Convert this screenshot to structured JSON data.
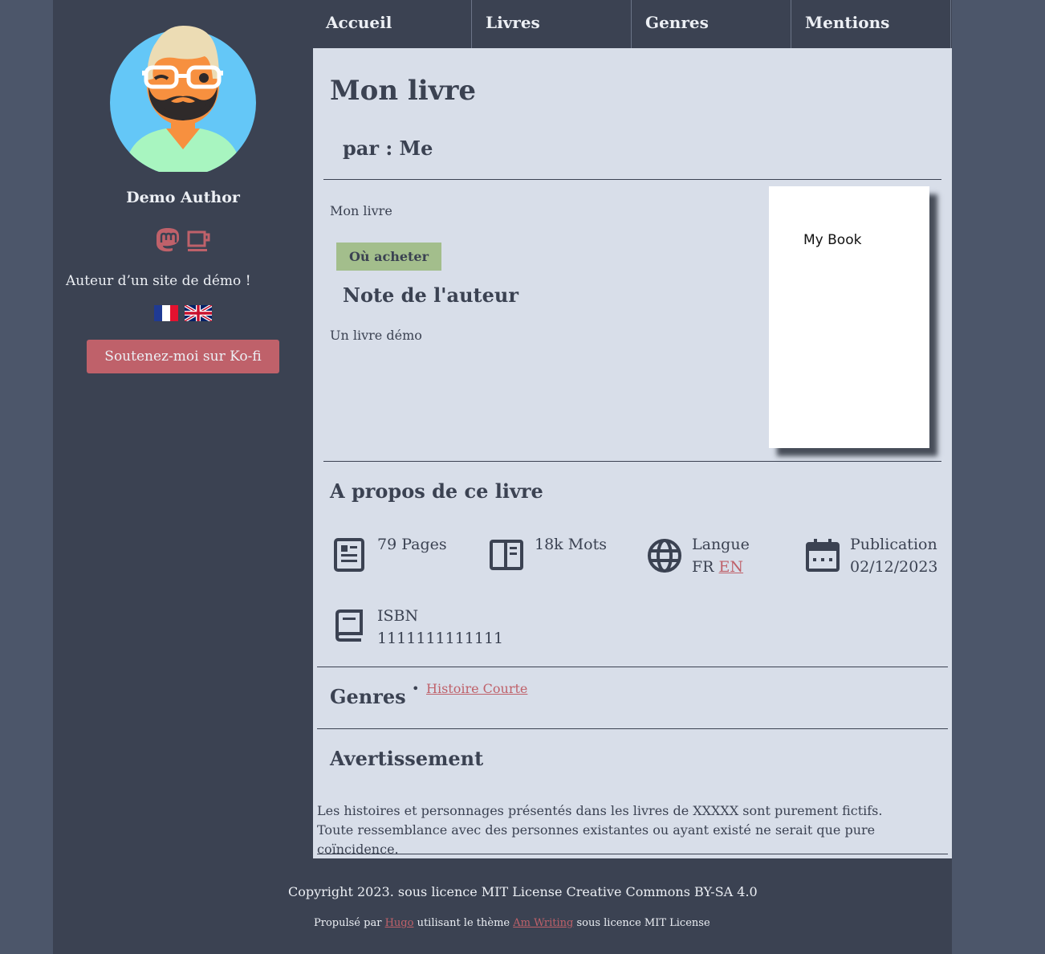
{
  "sidebar": {
    "author_name": "Demo Author",
    "tagline": "Auteur d’un site de démo !",
    "kofi_label": "Soutenez-moi sur Ko-fi",
    "icons": [
      "mastodon-icon",
      "kofi-cup-icon"
    ],
    "flags": [
      "fr-flag",
      "uk-flag"
    ]
  },
  "nav": {
    "items": [
      "Accueil",
      "Livres",
      "Genres",
      "Mentions légales"
    ]
  },
  "book": {
    "title": "Mon livre",
    "byline": "par : Me",
    "summary": "Mon livre",
    "buy_label": "Où acheter",
    "note_heading": "Note de l'auteur",
    "note_text": "Un livre démo",
    "cover_text": "My Book"
  },
  "about": {
    "heading": "A propos de ce livre",
    "pages": "79 Pages",
    "words": "18k Mots",
    "language_label": "Langue",
    "language_fr": "FR",
    "language_en": "EN",
    "publication_label": "Publication",
    "publication_date": "02/12/2023",
    "isbn_label": "ISBN",
    "isbn_value": "1111111111111"
  },
  "genres": {
    "heading": "Genres",
    "items": [
      "Histoire Courte"
    ]
  },
  "warning": {
    "heading": "Avertissement",
    "text": "Les histoires et personnages présentés dans les livres de XXXXX sont purement fictifs. Toute ressemblance avec des personnes existantes ou ayant existé ne serait que pure coïncidence."
  },
  "footer": {
    "copyright": "Copyright 2023. sous licence MIT License Creative Commons BY-SA 4.0",
    "powered_prefix": "Propulsé par",
    "powered_hugo": "Hugo",
    "powered_middle": "utilisant le thème",
    "powered_theme": "Am Writing",
    "powered_suffix": "sous licence MIT License"
  },
  "colors": {
    "sidebar_bg": "#3b4252",
    "content_bg": "#d8dee9",
    "accent": "#bf616a",
    "buy_button": "#a3be8c",
    "outer_bg": "#4c566a"
  }
}
